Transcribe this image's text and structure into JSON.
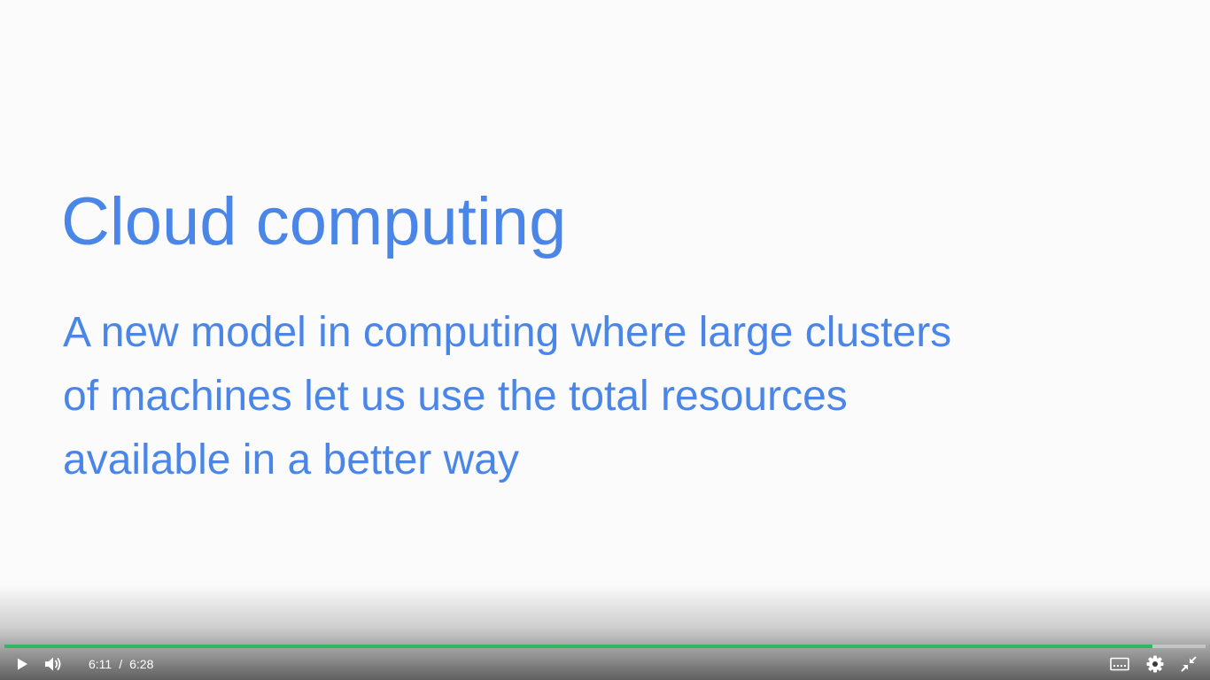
{
  "slide": {
    "title": "Cloud computing",
    "body_lines": [
      "A new model in computing where large clusters",
      "of machines let us use the total resources",
      "available in a better way"
    ],
    "text_color": "#4a86e8",
    "background": "#fbfbfc"
  },
  "player": {
    "current_time": "6:11",
    "separator": "/",
    "duration": "6:28",
    "progress_fraction": 0.956,
    "progress_color": "#2fb864",
    "icons": {
      "play": "play-icon",
      "volume": "volume-icon",
      "captions": "captions-icon",
      "settings": "gear-icon",
      "exit_fullscreen": "exit-fullscreen-icon"
    }
  }
}
